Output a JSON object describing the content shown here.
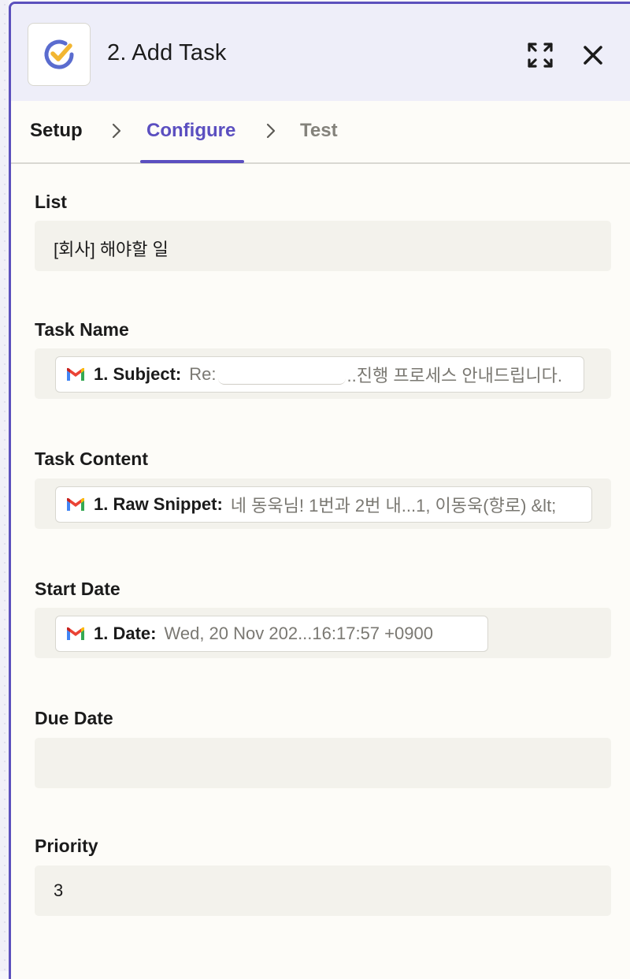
{
  "header": {
    "title": "2. Add Task"
  },
  "tabs": [
    {
      "label": "Setup"
    },
    {
      "label": "Configure"
    },
    {
      "label": "Test"
    }
  ],
  "fields": {
    "list": {
      "label": "List",
      "value": "[회사] 해야할 일"
    },
    "task_name": {
      "label": "Task Name",
      "pill_key": "1. Subject:",
      "pill_value_prefix": "Re:",
      "pill_value_suffix": "..진행 프로세스 안내드립니다."
    },
    "task_content": {
      "label": "Task Content",
      "pill_key": "1. Raw Snippet:",
      "pill_value": "네 동욱님! 1번과 2번 내...1, 이동욱(향로) &lt;"
    },
    "start_date": {
      "label": "Start Date",
      "pill_key": "1. Date:",
      "pill_value": "Wed, 20 Nov 202...16:17:57 +0900"
    },
    "due_date": {
      "label": "Due Date",
      "value": ""
    },
    "priority": {
      "label": "Priority",
      "value": "3"
    }
  },
  "colors": {
    "accent": "#5b4fc0",
    "panel_border": "#5b50bd",
    "header_bg": "#eeeef9",
    "field_bg": "#f3f2ec"
  },
  "icons": {
    "app": "ticktick-check-icon",
    "expand": "expand-icon",
    "close": "close-icon",
    "gmail": "gmail-icon",
    "chevron": "chevron-right-icon"
  }
}
